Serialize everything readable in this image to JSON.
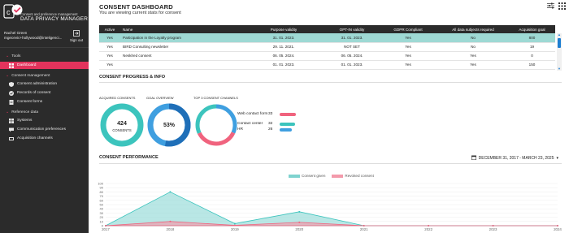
{
  "app": {
    "subtitle": "Consent and preference management",
    "title": "DATA PRIVACY MANAGER",
    "version": "2.2"
  },
  "user": {
    "name": "Rachel Green",
    "email": "mgecevic+hollywood@inteligenci...",
    "signout_label": "Sign out"
  },
  "sidebar": {
    "tools": {
      "label": "Tools",
      "items": [
        {
          "label": "Dashboard",
          "icon": "dashboard-icon",
          "active": true
        }
      ]
    },
    "consent_management": {
      "label": "Consent management",
      "items": [
        {
          "label": "Consent administration",
          "icon": "shield-icon"
        },
        {
          "label": "Records of consent",
          "icon": "check-circle-icon"
        },
        {
          "label": "Consent forms",
          "icon": "form-icon"
        }
      ]
    },
    "reference_data": {
      "label": "Reference data",
      "items": [
        {
          "label": "Systems",
          "icon": "windows-icon"
        },
        {
          "label": "Communication preferences",
          "icon": "chat-icon"
        },
        {
          "label": "Acquisition channels",
          "icon": "channel-icon"
        }
      ]
    }
  },
  "header": {
    "title": "CONSENT DASHBOARD",
    "subtitle": "You are viewing current stats for consent"
  },
  "table": {
    "columns": [
      "Active",
      "Name",
      "Purpose validity",
      "OPT-IN validity",
      "GDPR Compliant",
      "All data subjects required",
      "Acquisition goal"
    ],
    "rows": [
      [
        "Yes",
        "Participation in the Loyalty program",
        "31. 01. 2023.",
        "31. 01. 2023.",
        "Yes",
        "No",
        "800"
      ],
      [
        "Yes",
        "BIRD Consulting newsletter",
        "29. 11. 2021.",
        "NOT SET",
        "Yes",
        "No",
        "19"
      ],
      [
        "Yes",
        "Nesklred consent",
        "06. 05. 2024.",
        "06. 05. 2024.",
        "Yes",
        "Yes",
        "0"
      ],
      [
        "Yes",
        "",
        "01. 01. 2023.",
        "01. 01. 2023.",
        "Yes",
        "Yes",
        "150"
      ]
    ]
  },
  "progress": {
    "section_title": "CONSENT PROGRESS & INFO",
    "acquired": {
      "label": "ACQUIRED CONSENTS",
      "value": "424",
      "unit": "CONSENTS"
    },
    "goal": {
      "label": "GOAL OVERVIEW",
      "value": "53%",
      "fraction": 0.53
    },
    "channels": {
      "label": "TOP 3 CONSENT CHANNELS",
      "items": [
        {
          "name": "Web contact form",
          "value": "33",
          "color": "#f0637e"
        },
        {
          "name": "Contact center",
          "value": "32",
          "color": "#3cc4bd"
        },
        {
          "name": "HR",
          "value": "26",
          "color": "#3f9fe0"
        }
      ]
    }
  },
  "performance": {
    "section_title": "CONSENT PERFORMANCE",
    "date_range": "DECEMBER 31, 2017 - MARCH 23, 2025"
  },
  "colors": {
    "accent": "#e2335c",
    "teal": "#3cc4bd",
    "blue": "#3f9fe0",
    "pink": "#f0637e",
    "sidebar": "#2b2b2b"
  },
  "chart_data": {
    "type": "area",
    "x": [
      "2017",
      "2018",
      "2019",
      "2020",
      "2021",
      "2022",
      "2023",
      "2024"
    ],
    "series": [
      {
        "name": "Consent given",
        "color": "#7fd3cf",
        "values": [
          0,
          80,
          5,
          33,
          0,
          0,
          0,
          0
        ]
      },
      {
        "name": "Revoked consent",
        "color": "#f39aab",
        "values": [
          0,
          10,
          1,
          8,
          0,
          0,
          0,
          0
        ]
      }
    ],
    "yticks": [
      "0",
      "10",
      "20",
      "30",
      "40",
      "50",
      "60",
      "70",
      "80",
      "90",
      "100"
    ],
    "ylim": [
      0,
      100
    ],
    "legend": "top-center"
  }
}
